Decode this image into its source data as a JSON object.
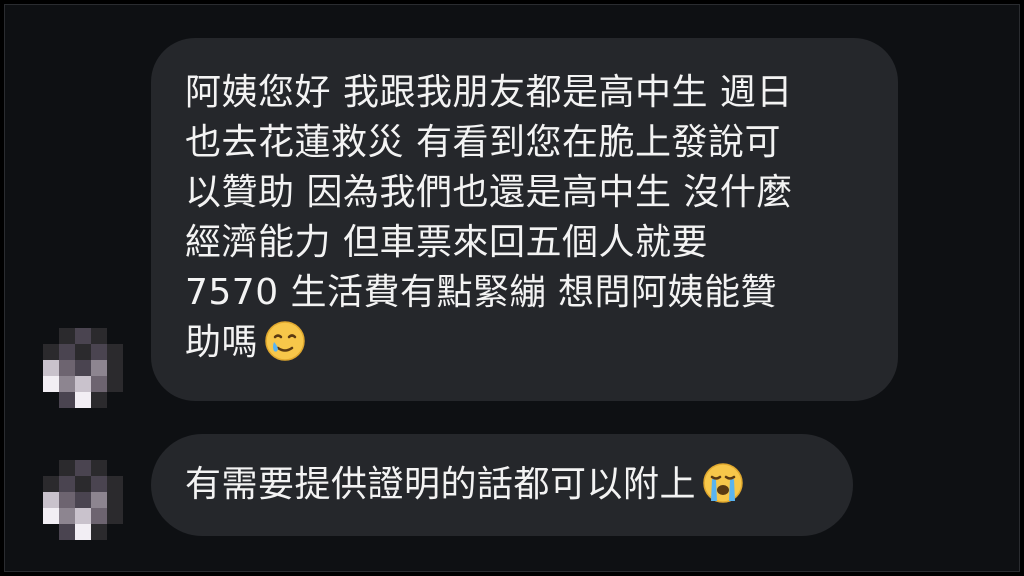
{
  "conversation": {
    "messages": [
      {
        "lines": [
          "阿姨您好 我跟我朋友都是高中生 週日",
          "也去花蓮救災 有看到您在脆上發說可",
          "以贊助 因為我們也還是高中生 沒什麼",
          "經濟能力 但車票來回五個人就要",
          "7570 生活費有點緊繃 想問阿姨能贊",
          "助嗎"
        ],
        "emoji": "smiling-face-with-tear"
      },
      {
        "text": "有需要提供證明的話都可以附上",
        "emoji": "loudly-crying-face"
      }
    ]
  },
  "avatar": {
    "state": "pixelated-blurred",
    "palette": [
      "#0e1013",
      "#2b2a2d",
      "#4a4450",
      "#6d6470",
      "#8d8590",
      "#c9c2cc",
      "#f2eef4"
    ]
  }
}
